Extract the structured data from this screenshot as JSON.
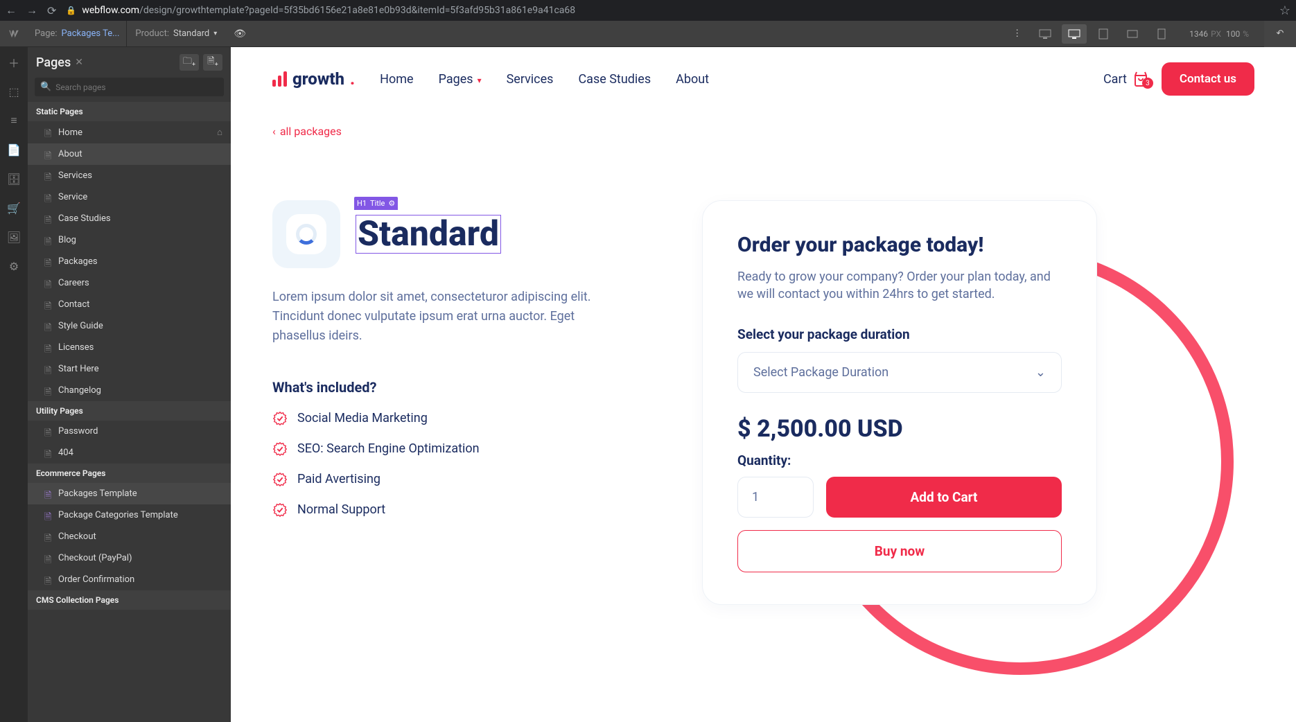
{
  "browser": {
    "url_host": "webflow.com",
    "url_path": "/design/growthtemplate?pageId=5f35bd6156e21a8e81e0b93d&itemId=5f3afd95b31a861e9a41ca68"
  },
  "topbar": {
    "page_label": "Page:",
    "page_value": "Packages Te...",
    "product_label": "Product:",
    "product_value": "Standard",
    "width": "1346",
    "width_unit": "PX",
    "zoom": "100",
    "zoom_unit": "%"
  },
  "panel": {
    "title": "Pages",
    "search_placeholder": "Search pages",
    "sections": {
      "static": "Static Pages",
      "utility": "Utility Pages",
      "ecommerce": "Ecommerce Pages",
      "cms": "CMS Collection Pages"
    },
    "static_pages": [
      "Home",
      "About",
      "Services",
      "Service",
      "Case Studies",
      "Blog",
      "Packages",
      "Careers",
      "Contact",
      "Style Guide",
      "Licenses",
      "Start Here",
      "Changelog"
    ],
    "utility_pages": [
      "Password",
      "404"
    ],
    "ecommerce_pages": [
      "Packages Template",
      "Package Categories Template",
      "Checkout",
      "Checkout (PayPal)",
      "Order Confirmation"
    ]
  },
  "site": {
    "logo_text": "growth",
    "nav": [
      "Home",
      "Pages",
      "Services",
      "Case Studies",
      "About"
    ],
    "cart_label": "Cart",
    "cart_count": "3",
    "contact_btn": "Contact us",
    "back_link": "all packages",
    "selection_badge_tag": "H1",
    "selection_badge_name": "Title",
    "product_title": "Standard",
    "description": "Lorem ipsum dolor sit amet, consecteturor adipiscing elit. Tincidunt donec vulputate ipsum erat urna auctor. Eget phasellus ideirs.",
    "included_heading": "What's included?",
    "features": [
      "Social Media Marketing",
      "SEO: Search Engine Optimization",
      "Paid Avertising",
      "Normal Support"
    ],
    "order": {
      "heading": "Order your package today!",
      "sub": "Ready to grow your company? Order your plan today, and we will contact you within 24hrs to get started.",
      "duration_label": "Select your package duration",
      "duration_placeholder": "Select Package Duration",
      "price": "$ 2,500.00 USD",
      "qty_label": "Quantity:",
      "qty_value": "1",
      "add_btn": "Add to Cart",
      "buy_btn": "Buy now"
    }
  }
}
